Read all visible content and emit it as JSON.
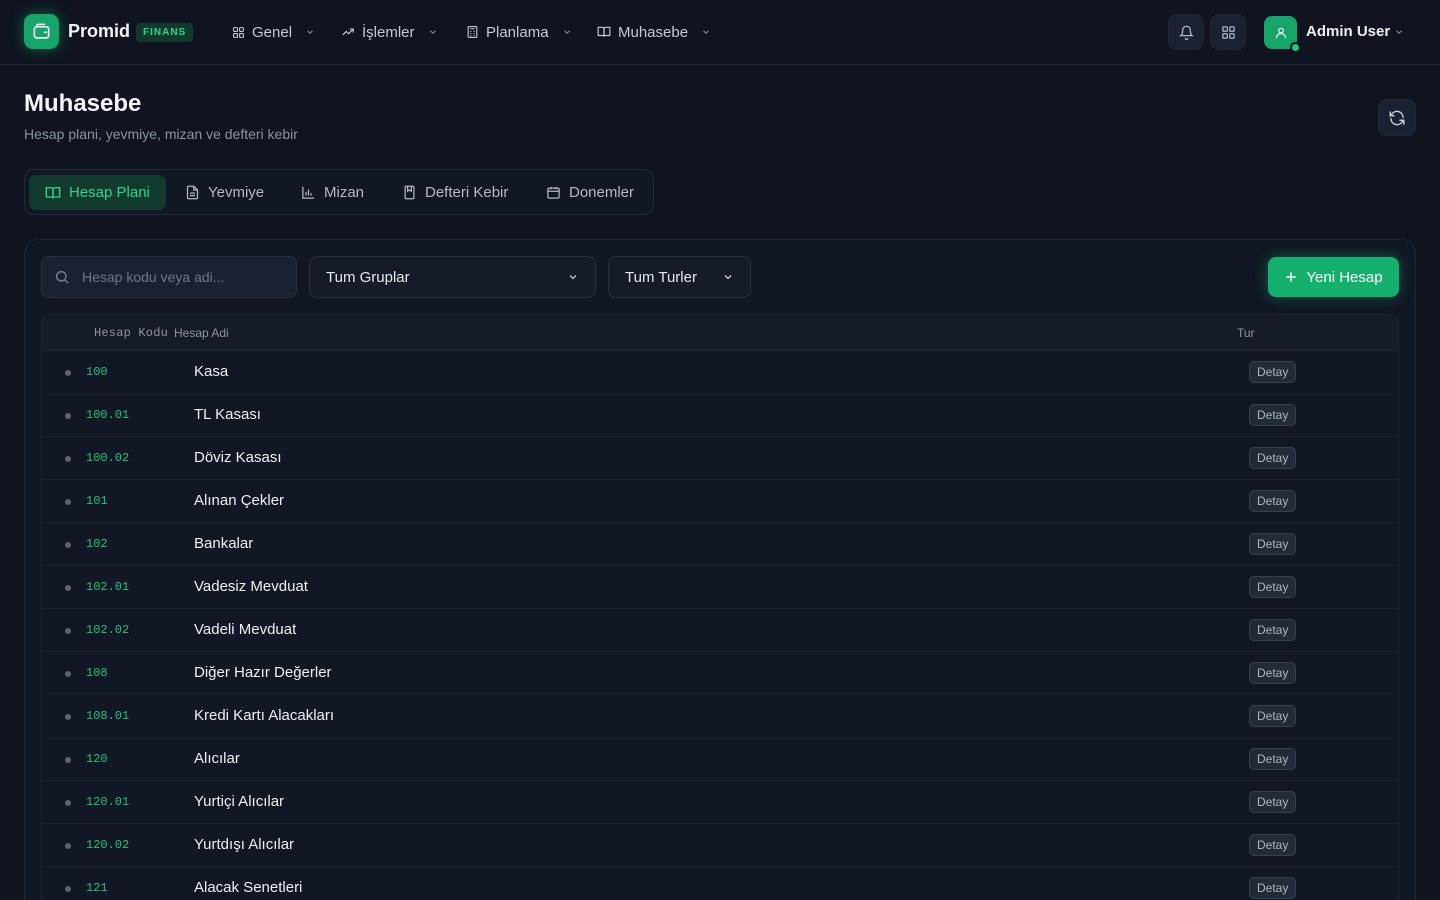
{
  "brand": {
    "name": "Promid",
    "badge": "FINANS"
  },
  "nav": {
    "items": [
      {
        "label": "Genel",
        "icon": "grid-icon"
      },
      {
        "label": "İşlemler",
        "icon": "trend-icon"
      },
      {
        "label": "Planlama",
        "icon": "calculator-icon"
      },
      {
        "label": "Muhasebe",
        "icon": "book-icon"
      }
    ]
  },
  "user": {
    "name": "Admin User"
  },
  "page": {
    "title": "Muhasebe",
    "subtitle": "Hesap plani, yevmiye, mizan ve defteri kebir"
  },
  "tabs": [
    {
      "label": "Hesap Plani",
      "icon": "book-open-icon",
      "active": true
    },
    {
      "label": "Yevmiye",
      "icon": "document-icon",
      "active": false
    },
    {
      "label": "Mizan",
      "icon": "bar-chart-icon",
      "active": false
    },
    {
      "label": "Defteri Kebir",
      "icon": "ledger-icon",
      "active": false
    },
    {
      "label": "Donemler",
      "icon": "calendar-icon",
      "active": false
    }
  ],
  "filters": {
    "search_placeholder": "Hesap kodu veya adi...",
    "group_select": "Tum Gruplar",
    "type_select": "Tum Turler",
    "new_button": "Yeni Hesap"
  },
  "table": {
    "columns": {
      "code": "Hesap Kodu",
      "name": "Hesap Adi",
      "type": "Tur"
    },
    "rows": [
      {
        "code": "100",
        "name": "Kasa",
        "type": "Detay"
      },
      {
        "code": "100.01",
        "name": "TL Kasası",
        "type": "Detay"
      },
      {
        "code": "100.02",
        "name": "Döviz Kasası",
        "type": "Detay"
      },
      {
        "code": "101",
        "name": "Alınan Çekler",
        "type": "Detay"
      },
      {
        "code": "102",
        "name": "Bankalar",
        "type": "Detay"
      },
      {
        "code": "102.01",
        "name": "Vadesiz Mevduat",
        "type": "Detay"
      },
      {
        "code": "102.02",
        "name": "Vadeli Mevduat",
        "type": "Detay"
      },
      {
        "code": "108",
        "name": "Diğer Hazır Değerler",
        "type": "Detay"
      },
      {
        "code": "108.01",
        "name": "Kredi Kartı Alacakları",
        "type": "Detay"
      },
      {
        "code": "120",
        "name": "Alıcılar",
        "type": "Detay"
      },
      {
        "code": "120.01",
        "name": "Yurtiçi Alıcılar",
        "type": "Detay"
      },
      {
        "code": "120.02",
        "name": "Yurtdışı Alıcılar",
        "type": "Detay"
      },
      {
        "code": "121",
        "name": "Alacak Senetleri",
        "type": "Detay"
      }
    ]
  },
  "colors": {
    "accent": "#16b06e",
    "background": "#0f1420",
    "code_text": "#22c47e"
  }
}
